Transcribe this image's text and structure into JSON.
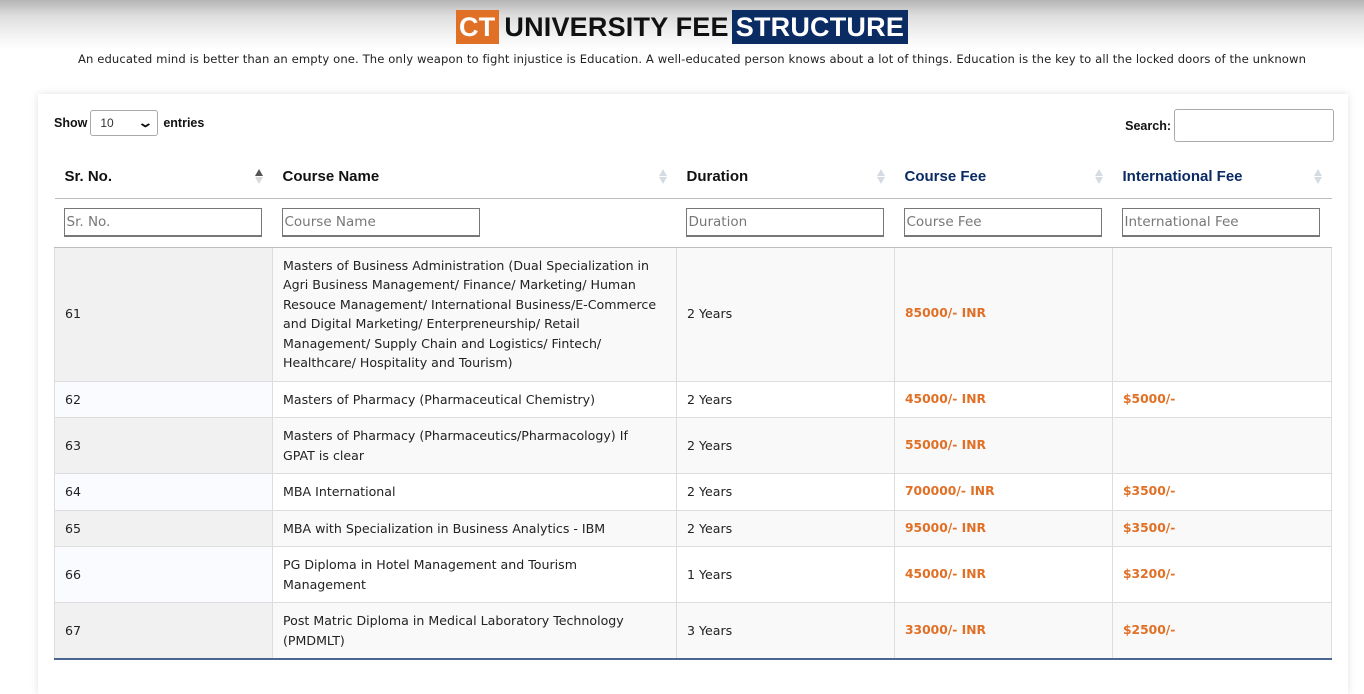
{
  "header": {
    "brand_badge": "CT",
    "title_middle": "UNIVERSITY FEE",
    "title_highlight": "STRUCTURE",
    "tagline": "An educated mind is better than an empty one. The only weapon to fight injustice is Education. A well-educated person knows about a lot of things. Education is the key to all the locked doors of the unknown"
  },
  "controls": {
    "show_label": "Show",
    "entries_value": "10",
    "entries_label": "entries",
    "search_label": "Search:",
    "search_value": ""
  },
  "colors": {
    "brand_orange": "#e07026",
    "brand_navy": "#0b2b63"
  },
  "table": {
    "columns": [
      {
        "label": "Sr. No.",
        "filter_placeholder": "Sr. No.",
        "sort": "ascending"
      },
      {
        "label": "Course Name",
        "filter_placeholder": "Course Name",
        "sort": "none"
      },
      {
        "label": "Duration",
        "filter_placeholder": "Duration",
        "sort": "none"
      },
      {
        "label": "Course Fee",
        "filter_placeholder": "Course Fee",
        "sort": "none"
      },
      {
        "label": "International Fee",
        "filter_placeholder": "International Fee",
        "sort": "none"
      }
    ],
    "rows": [
      {
        "sr": "61",
        "course": "Masters of Business Administration (Dual Specialization in Agri Business Management/ Finance/ Marketing/ Human Resouce Management/ International Business/E-Commerce and Digital Marketing/ Enterpreneurship/ Retail Management/ Supply Chain and Logistics/ Fintech/ Healthcare/ Hospitality and Tourism)",
        "duration": "2 Years",
        "fee": "85000/- INR",
        "intl_fee": ""
      },
      {
        "sr": "62",
        "course": "Masters of Pharmacy (Pharmaceutical Chemistry)",
        "duration": "2 Years",
        "fee": "45000/- INR",
        "intl_fee": "$5000/-"
      },
      {
        "sr": "63",
        "course": "Masters of Pharmacy (Pharmaceutics/Pharmacology) If GPAT is clear",
        "duration": "2 Years",
        "fee": "55000/- INR",
        "intl_fee": ""
      },
      {
        "sr": "64",
        "course": "MBA International",
        "duration": "2 Years",
        "fee": "700000/- INR",
        "intl_fee": "$3500/-"
      },
      {
        "sr": "65",
        "course": "MBA with Specialization in Business Analytics - IBM",
        "duration": "2 Years",
        "fee": "95000/- INR",
        "intl_fee": "$3500/-"
      },
      {
        "sr": "66",
        "course": "PG Diploma in Hotel Management and Tourism Management",
        "duration": "1 Years",
        "fee": "45000/- INR",
        "intl_fee": "$3200/-"
      },
      {
        "sr": "67",
        "course": "Post Matric Diploma in Medical Laboratory Technology (PMDMLT)",
        "duration": "3 Years",
        "fee": "33000/- INR",
        "intl_fee": "$2500/-"
      }
    ]
  }
}
